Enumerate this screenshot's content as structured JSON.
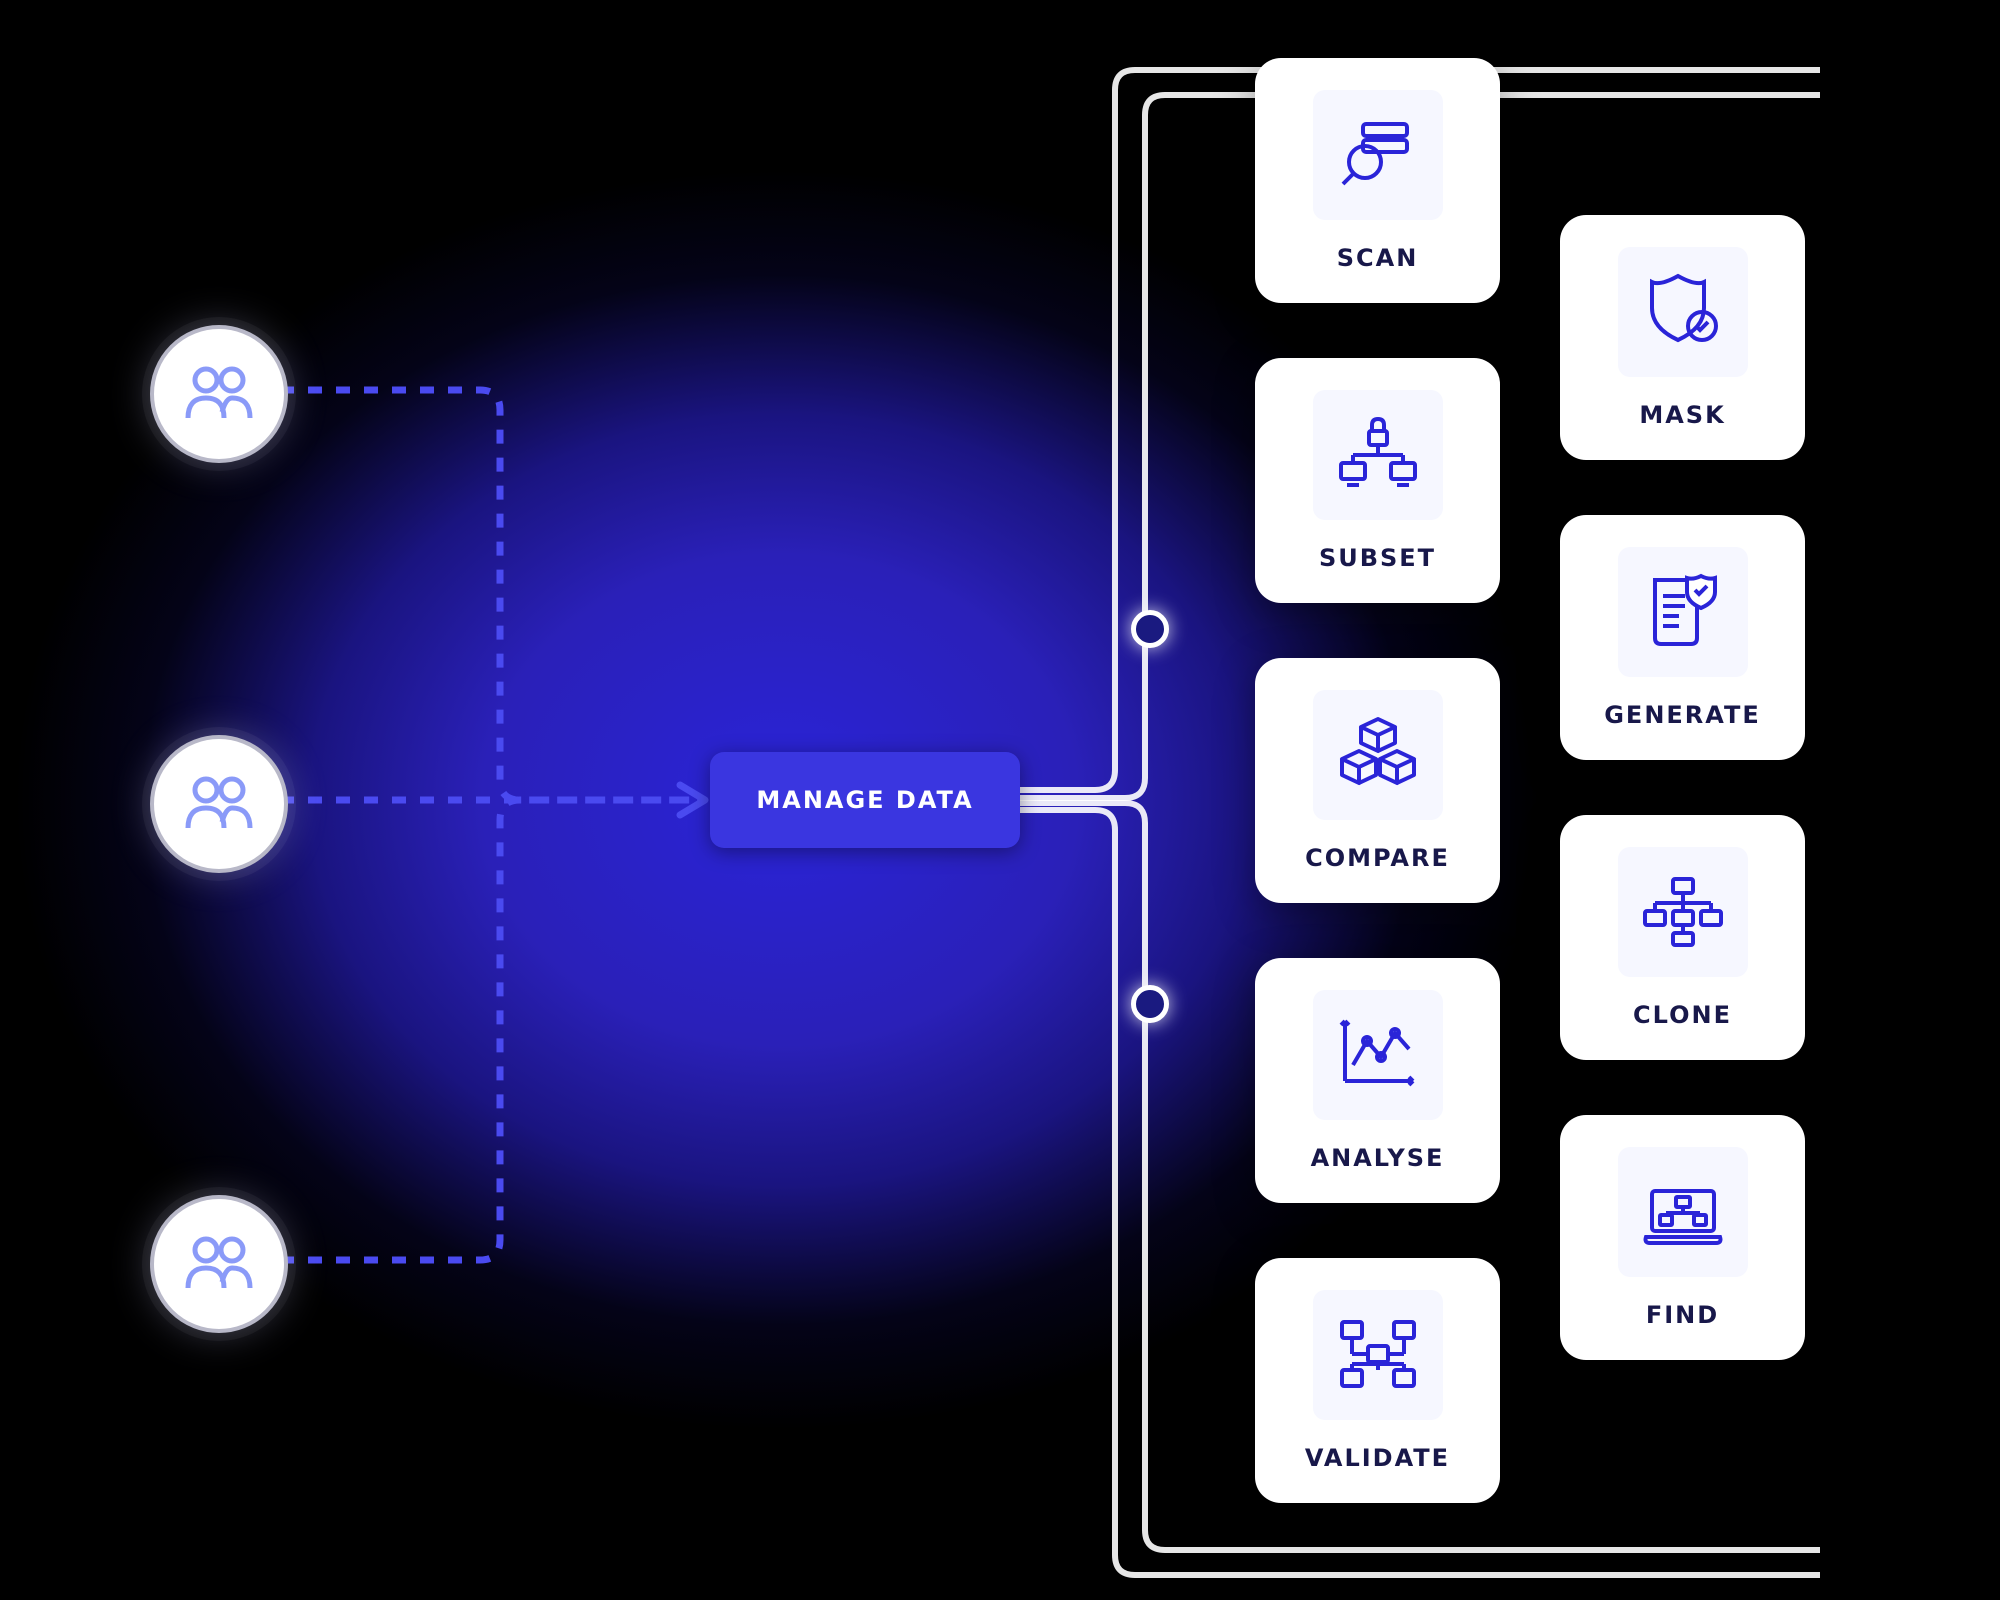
{
  "colors": {
    "accent": "#3a36e0",
    "icon": "#2a24d8",
    "bg_glow": "#2a24d8",
    "card_bg": "#ffffff",
    "icon_bg": "#f6f7ff",
    "text": "#18184a"
  },
  "inputs": {
    "users": [
      {
        "icon": "users-icon"
      },
      {
        "icon": "users-icon"
      },
      {
        "icon": "users-icon"
      }
    ]
  },
  "hub": {
    "label": "MANAGE DATA"
  },
  "outputs": {
    "left_column": [
      {
        "label": "SCAN",
        "icon": "search-db-icon"
      },
      {
        "label": "SUBSET",
        "icon": "network-lock-icon"
      },
      {
        "label": "COMPARE",
        "icon": "blocks-icon"
      },
      {
        "label": "ANALYSE",
        "icon": "chart-line-icon"
      },
      {
        "label": "VALIDATE",
        "icon": "validate-tree-icon"
      }
    ],
    "right_column": [
      {
        "label": "MASK",
        "icon": "shield-check-icon"
      },
      {
        "label": "GENERATE",
        "icon": "document-shield-icon"
      },
      {
        "label": "CLONE",
        "icon": "sitemap-icon"
      },
      {
        "label": "FIND",
        "icon": "laptop-tree-icon"
      }
    ]
  }
}
